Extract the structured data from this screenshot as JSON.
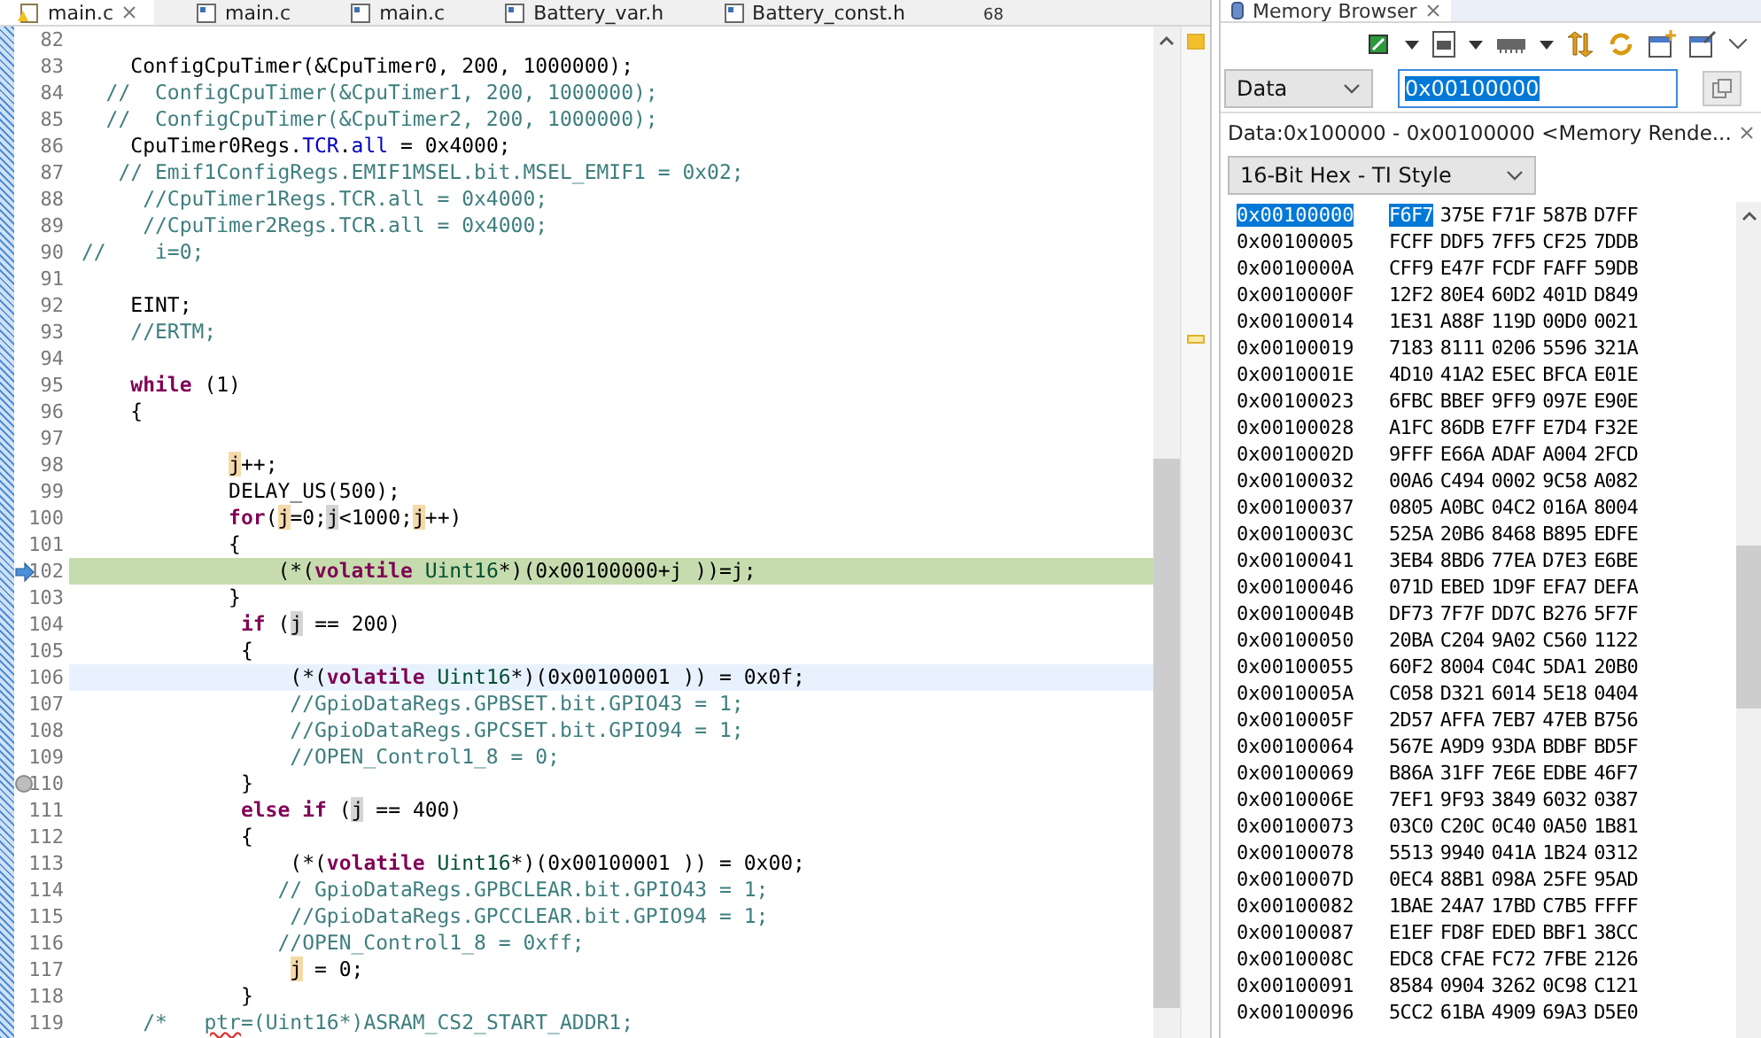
{
  "editor": {
    "tabs": [
      {
        "label": "main.c",
        "kind": "source-warning",
        "selected": true
      },
      {
        "label": "main.c",
        "kind": "source",
        "selected": false
      },
      {
        "label": "main.c",
        "kind": "source",
        "selected": false
      },
      {
        "label": "Battery_var.h",
        "kind": "header",
        "selected": false
      },
      {
        "label": "Battery_const.h",
        "kind": "header",
        "selected": false
      }
    ],
    "overflow_count": "68",
    "lines": [
      {
        "num": "82"
      },
      {
        "num": "83",
        "segments": [
          {
            "text": "    ConfigCpuTimer(&CpuTimer0, 200, 1000000);",
            "kind": "plain"
          }
        ]
      },
      {
        "num": "84",
        "segments": [
          {
            "text": "  //  ConfigCpuTimer(&CpuTimer1, 200, 1000000);",
            "kind": "comment"
          }
        ]
      },
      {
        "num": "85",
        "segments": [
          {
            "text": "  //  ConfigCpuTimer(&CpuTimer2, 200, 1000000);",
            "kind": "comment"
          }
        ]
      },
      {
        "num": "86",
        "segments": [
          {
            "text": "    CpuTimer0Regs.",
            "kind": "plain"
          },
          {
            "text": "TCR",
            "kind": "field"
          },
          {
            "text": ".",
            "kind": "plain"
          },
          {
            "text": "all",
            "kind": "field"
          },
          {
            "text": " = 0x4000;",
            "kind": "plain"
          }
        ]
      },
      {
        "num": "87",
        "segments": [
          {
            "text": "   // Emif1ConfigRegs.EMIF1MSEL.bit.MSEL_EMIF1 = 0x02;",
            "kind": "comment"
          }
        ]
      },
      {
        "num": "88",
        "segments": [
          {
            "text": "     //CpuTimer1Regs.TCR.all = 0x4000;",
            "kind": "comment"
          }
        ]
      },
      {
        "num": "89",
        "segments": [
          {
            "text": "     //CpuTimer2Regs.TCR.all = 0x4000;",
            "kind": "comment"
          }
        ]
      },
      {
        "num": "90",
        "segments": [
          {
            "text": "//    i=0;",
            "kind": "comment"
          }
        ]
      },
      {
        "num": "91"
      },
      {
        "num": "92",
        "segments": [
          {
            "text": "    EINT;",
            "kind": "plain"
          }
        ]
      },
      {
        "num": "93",
        "segments": [
          {
            "text": "    //ERTM;",
            "kind": "comment"
          }
        ]
      },
      {
        "num": "94"
      },
      {
        "num": "95",
        "segments": [
          {
            "text": "    while",
            "kind": "keyword"
          },
          {
            "text": " (1)",
            "kind": "plain"
          }
        ]
      },
      {
        "num": "96",
        "segments": [
          {
            "text": "    {",
            "kind": "plain"
          }
        ]
      },
      {
        "num": "97"
      },
      {
        "num": "98",
        "segments": [
          {
            "text": "            j",
            "kind": "write-occurrence"
          },
          {
            "text": "++;",
            "kind": "plain"
          }
        ]
      },
      {
        "num": "99",
        "segments": [
          {
            "text": "            DELAY_US(500);",
            "kind": "plain"
          }
        ]
      },
      {
        "num": "100",
        "segments": [
          {
            "text": "            for",
            "kind": "keyword"
          },
          {
            "text": "(",
            "kind": "plain"
          },
          {
            "text": "j",
            "kind": "write-occurrence"
          },
          {
            "text": "=0;",
            "kind": "plain"
          },
          {
            "text": "j",
            "kind": "read-occurrence"
          },
          {
            "text": "<1000;",
            "kind": "plain"
          },
          {
            "text": "j",
            "kind": "write-occurrence"
          },
          {
            "text": "++)",
            "kind": "plain"
          }
        ]
      },
      {
        "num": "101",
        "segments": [
          {
            "text": "            {",
            "kind": "plain"
          }
        ]
      },
      {
        "num": "102",
        "execution_point": true,
        "segments": [
          {
            "text": "                (*(",
            "kind": "plain"
          },
          {
            "text": "volatile",
            "kind": "keyword"
          },
          {
            "text": " Uint16",
            "kind": "type"
          },
          {
            "text": "*)(0x00100000+j ))=j;",
            "kind": "plain"
          }
        ]
      },
      {
        "num": "103",
        "segments": [
          {
            "text": "            }",
            "kind": "plain"
          }
        ]
      },
      {
        "num": "104",
        "segments": [
          {
            "text": "             if",
            "kind": "keyword"
          },
          {
            "text": " (",
            "kind": "plain"
          },
          {
            "text": "j",
            "kind": "read-occurrence"
          },
          {
            "text": " == 200)",
            "kind": "plain"
          }
        ]
      },
      {
        "num": "105",
        "segments": [
          {
            "text": "             {",
            "kind": "plain"
          }
        ]
      },
      {
        "num": "106",
        "cursor_line": true,
        "segments": [
          {
            "text": "                 (*(",
            "kind": "plain"
          },
          {
            "text": "volatile",
            "kind": "keyword"
          },
          {
            "text": " Uint16",
            "kind": "type"
          },
          {
            "text": "*)(0x00100001 )) = 0x0f;",
            "kind": "plain"
          }
        ]
      },
      {
        "num": "107",
        "segments": [
          {
            "text": "                 //GpioDataRegs.GPBSET.bit.GPIO43 = 1;",
            "kind": "comment"
          }
        ]
      },
      {
        "num": "108",
        "segments": [
          {
            "text": "                 //GpioDataRegs.GPCSET.bit.GPIO94 = 1;",
            "kind": "comment"
          }
        ]
      },
      {
        "num": "109",
        "segments": [
          {
            "text": "                 //OPEN_Control1_8 = 0;",
            "kind": "comment"
          }
        ]
      },
      {
        "num": "110",
        "breakpoint": true,
        "segments": [
          {
            "text": "             }",
            "kind": "plain"
          }
        ]
      },
      {
        "num": "111",
        "segments": [
          {
            "text": "             else if",
            "kind": "keyword"
          },
          {
            "text": " (",
            "kind": "plain"
          },
          {
            "text": "j",
            "kind": "read-occurrence"
          },
          {
            "text": " == 400)",
            "kind": "plain"
          }
        ]
      },
      {
        "num": "112",
        "segments": [
          {
            "text": "             {",
            "kind": "plain"
          }
        ]
      },
      {
        "num": "113",
        "segments": [
          {
            "text": "                 (*(",
            "kind": "plain"
          },
          {
            "text": "volatile",
            "kind": "keyword"
          },
          {
            "text": " Uint16",
            "kind": "type"
          },
          {
            "text": "*)(0x00100001 )) = 0x00;",
            "kind": "plain"
          }
        ]
      },
      {
        "num": "114",
        "segments": [
          {
            "text": "                // GpioDataRegs.GPBCLEAR.bit.GPIO43 = 1;",
            "kind": "comment"
          }
        ]
      },
      {
        "num": "115",
        "segments": [
          {
            "text": "                 //GpioDataRegs.GPCCLEAR.bit.GPIO94 = 1;",
            "kind": "comment"
          }
        ]
      },
      {
        "num": "116",
        "segments": [
          {
            "text": "                //OPEN_Control1_8 = 0xff;",
            "kind": "comment"
          }
        ]
      },
      {
        "num": "117",
        "segments": [
          {
            "text": "                 j",
            "kind": "write-occurrence"
          },
          {
            "text": " = 0;",
            "kind": "plain"
          }
        ]
      },
      {
        "num": "118",
        "segments": [
          {
            "text": "             }",
            "kind": "plain"
          }
        ]
      },
      {
        "num": "119",
        "segments": [
          {
            "text": "     /*   ",
            "kind": "comment"
          },
          {
            "text": "ptr",
            "kind": "spelling"
          },
          {
            "text": "=(Uint16*)ASRAM_CS2_START_ADDR1;",
            "kind": "comment"
          }
        ]
      }
    ]
  },
  "memory_browser": {
    "title": "Memory Browser",
    "page": "Data",
    "address": "0x00100000",
    "rendering_tab": "Data:0x100000 - 0x00100000 <Memory Rende...",
    "format": "16-Bit Hex - TI Style",
    "rows": [
      {
        "address": "0x00100000",
        "values": [
          "F6F7",
          "375E",
          "F71F",
          "587B",
          "D7FF"
        ],
        "selected": true
      },
      {
        "address": "0x00100005",
        "values": [
          "FCFF",
          "DDF5",
          "7FF5",
          "CF25",
          "7DDB"
        ],
        "selected": false
      },
      {
        "address": "0x0010000A",
        "values": [
          "CFF9",
          "E47F",
          "FCDF",
          "FAFF",
          "59DB"
        ],
        "selected": false
      },
      {
        "address": "0x0010000F",
        "values": [
          "12F2",
          "80E4",
          "60D2",
          "401D",
          "D849"
        ],
        "selected": false
      },
      {
        "address": "0x00100014",
        "values": [
          "1E31",
          "A88F",
          "119D",
          "00D0",
          "0021"
        ],
        "selected": false
      },
      {
        "address": "0x00100019",
        "values": [
          "7183",
          "8111",
          "0206",
          "5596",
          "321A"
        ],
        "selected": false
      },
      {
        "address": "0x0010001E",
        "values": [
          "4D10",
          "41A2",
          "E5EC",
          "BFCA",
          "E01E"
        ],
        "selected": false
      },
      {
        "address": "0x00100023",
        "values": [
          "6FBC",
          "BBEF",
          "9FF9",
          "097E",
          "E90E"
        ],
        "selected": false
      },
      {
        "address": "0x00100028",
        "values": [
          "A1FC",
          "86DB",
          "E7FF",
          "E7D4",
          "F32E"
        ],
        "selected": false
      },
      {
        "address": "0x0010002D",
        "values": [
          "9FFF",
          "E66A",
          "ADAF",
          "A004",
          "2FCD"
        ],
        "selected": false
      },
      {
        "address": "0x00100032",
        "values": [
          "00A6",
          "C494",
          "0002",
          "9C58",
          "A082"
        ],
        "selected": false
      },
      {
        "address": "0x00100037",
        "values": [
          "0805",
          "A0BC",
          "04C2",
          "016A",
          "8004"
        ],
        "selected": false
      },
      {
        "address": "0x0010003C",
        "values": [
          "525A",
          "20B6",
          "8468",
          "B895",
          "EDFE"
        ],
        "selected": false
      },
      {
        "address": "0x00100041",
        "values": [
          "3EB4",
          "8BD6",
          "77EA",
          "D7E3",
          "E6BE"
        ],
        "selected": false
      },
      {
        "address": "0x00100046",
        "values": [
          "071D",
          "EBED",
          "1D9F",
          "EFA7",
          "DEFA"
        ],
        "selected": false
      },
      {
        "address": "0x0010004B",
        "values": [
          "DF73",
          "7F7F",
          "DD7C",
          "B276",
          "5F7F"
        ],
        "selected": false
      },
      {
        "address": "0x00100050",
        "values": [
          "20BA",
          "C204",
          "9A02",
          "C560",
          "1122"
        ],
        "selected": false
      },
      {
        "address": "0x00100055",
        "values": [
          "60F2",
          "8004",
          "C04C",
          "5DA1",
          "20B0"
        ],
        "selected": false
      },
      {
        "address": "0x0010005A",
        "values": [
          "C058",
          "D321",
          "6014",
          "5E18",
          "0404"
        ],
        "selected": false
      },
      {
        "address": "0x0010005F",
        "values": [
          "2D57",
          "AFFA",
          "7EB7",
          "47EB",
          "B756"
        ],
        "selected": false
      },
      {
        "address": "0x00100064",
        "values": [
          "567E",
          "A9D9",
          "93DA",
          "BDBF",
          "BD5F"
        ],
        "selected": false
      },
      {
        "address": "0x00100069",
        "values": [
          "B86A",
          "31FF",
          "7E6E",
          "EDBE",
          "46F7"
        ],
        "selected": false
      },
      {
        "address": "0x0010006E",
        "values": [
          "7EF1",
          "9F93",
          "3849",
          "6032",
          "0387"
        ],
        "selected": false
      },
      {
        "address": "0x00100073",
        "values": [
          "03C0",
          "C20C",
          "0C40",
          "0A50",
          "1B81"
        ],
        "selected": false
      },
      {
        "address": "0x00100078",
        "values": [
          "5513",
          "9940",
          "041A",
          "1B24",
          "0312"
        ],
        "selected": false
      },
      {
        "address": "0x0010007D",
        "values": [
          "0EC4",
          "88B1",
          "098A",
          "25FE",
          "95AD"
        ],
        "selected": false
      },
      {
        "address": "0x00100082",
        "values": [
          "1BAE",
          "24A7",
          "17BD",
          "C7B5",
          "FFFF"
        ],
        "selected": false
      },
      {
        "address": "0x00100087",
        "values": [
          "E1EF",
          "FD8F",
          "EDED",
          "BBF1",
          "38CC"
        ],
        "selected": false
      },
      {
        "address": "0x0010008C",
        "values": [
          "EDC8",
          "CFAE",
          "FC72",
          "7FBE",
          "2126"
        ],
        "selected": false
      },
      {
        "address": "0x00100091",
        "values": [
          "8584",
          "0904",
          "3262",
          "0C98",
          "C121"
        ],
        "selected": false
      },
      {
        "address": "0x00100096",
        "values": [
          "5CC2",
          "61BA",
          "4909",
          "69A3",
          "D5E0"
        ],
        "selected": false
      }
    ]
  }
}
